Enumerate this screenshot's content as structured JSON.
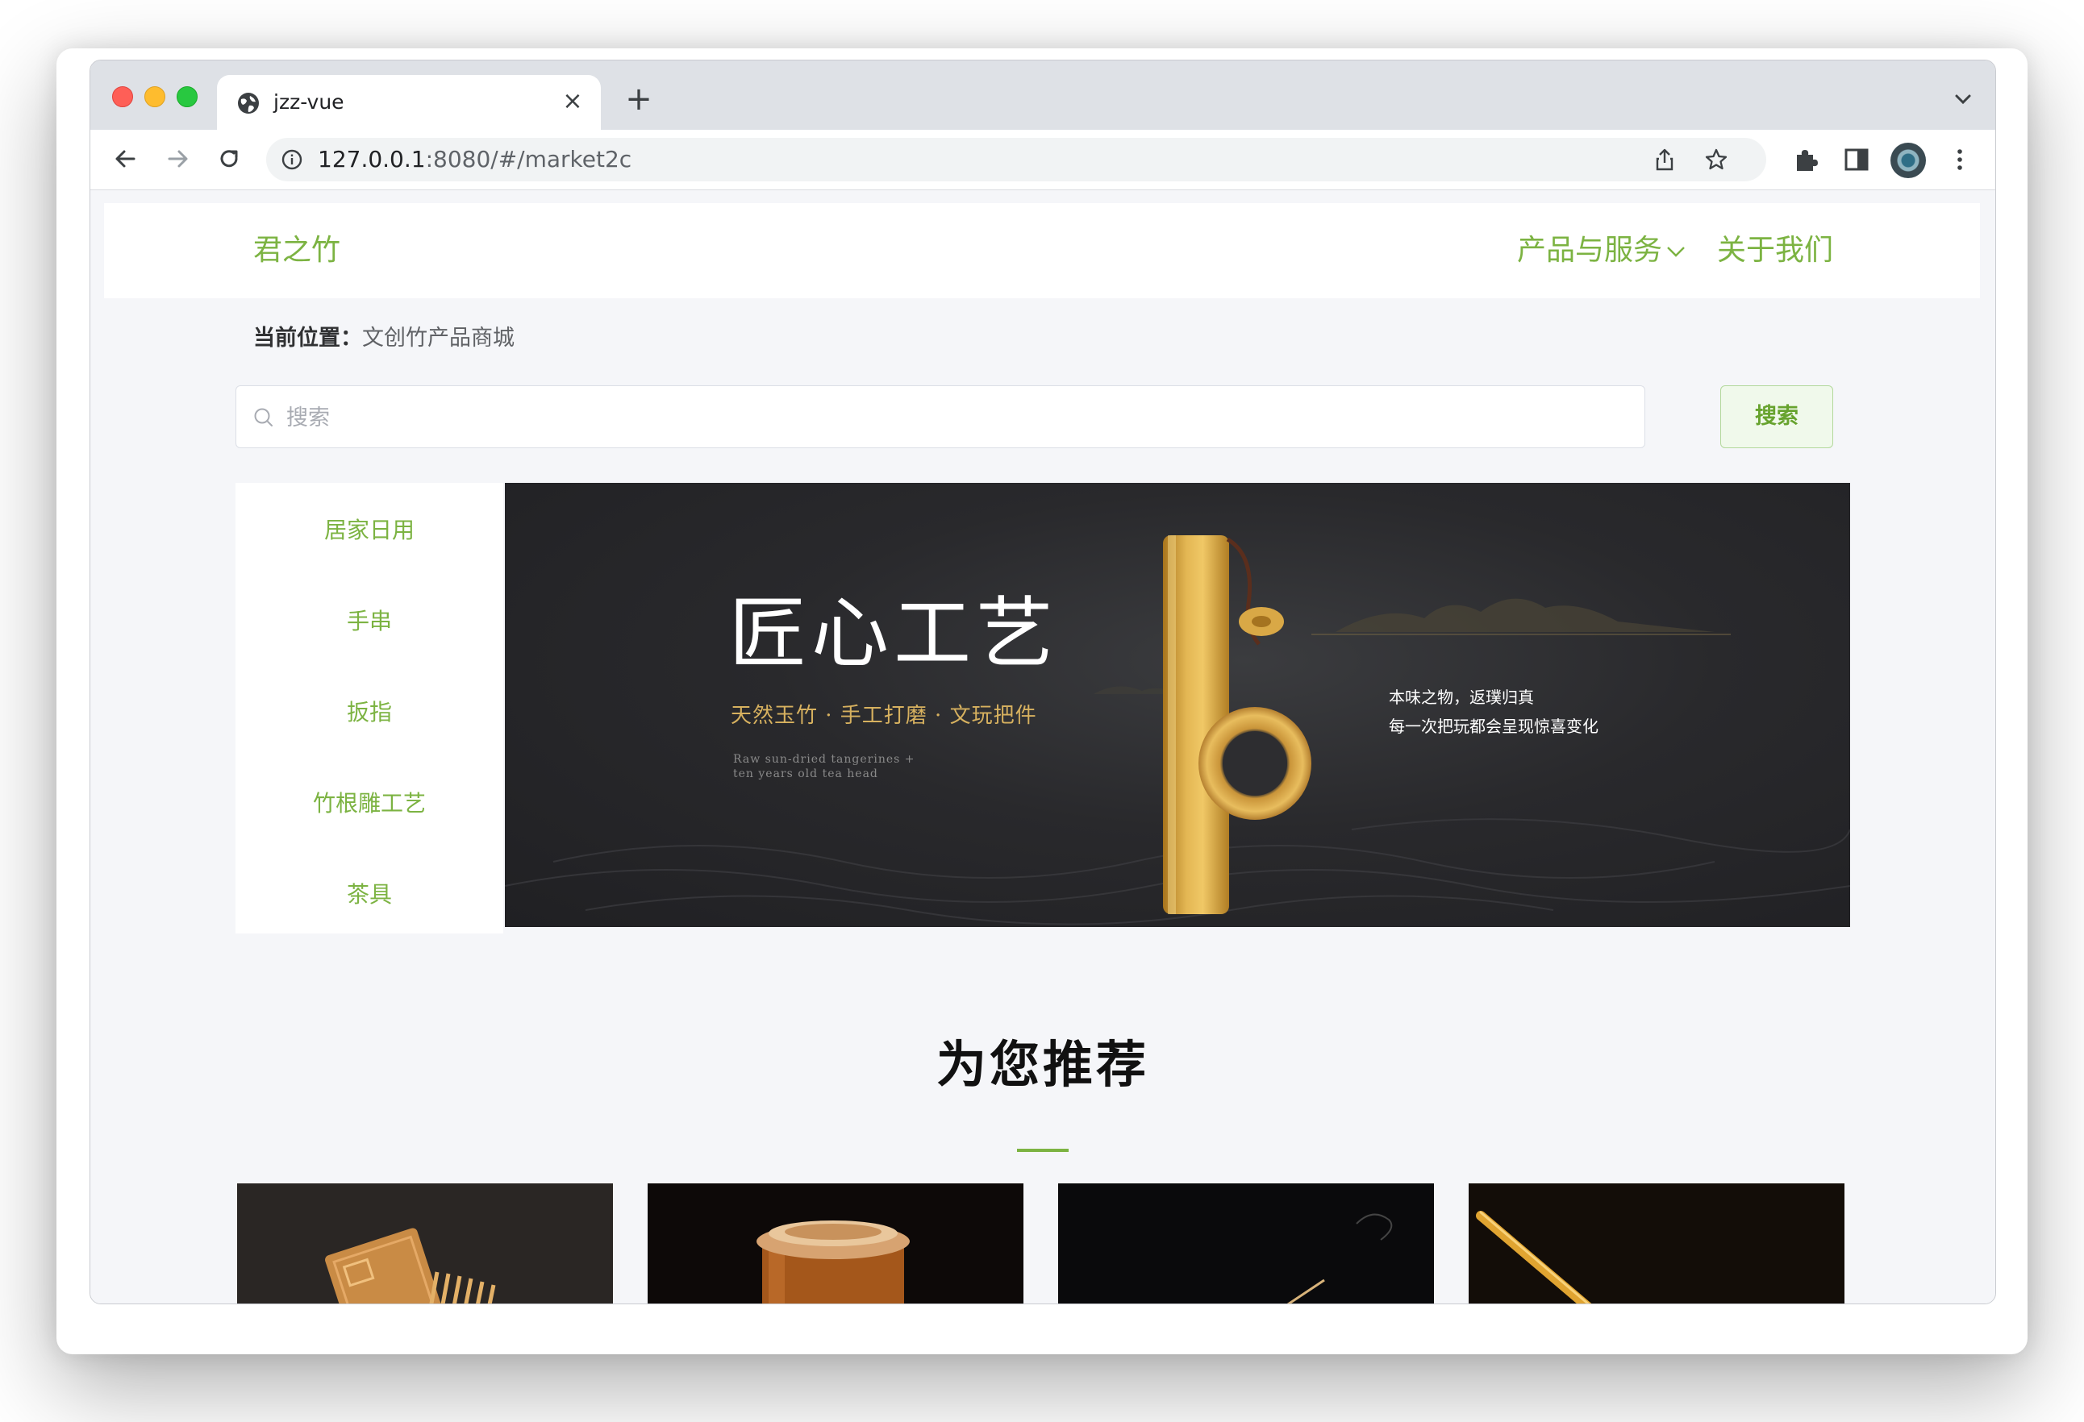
{
  "browser": {
    "tab_title": "jzz-vue",
    "url_host": "127.0.0.1",
    "url_rest": ":8080/#/market2c"
  },
  "header": {
    "logo": "君之竹",
    "menu_products": "产品与服务",
    "menu_about": "关于我们"
  },
  "breadcrumb": {
    "label": "当前位置：",
    "current": "文创竹产品商城"
  },
  "search": {
    "placeholder": "搜索",
    "button": "搜索"
  },
  "categories": [
    "居家日用",
    "手串",
    "扳指",
    "竹根雕工艺",
    "茶具"
  ],
  "banner": {
    "title": "匠心工艺",
    "subtitle": "天然玉竹 · 手工打磨 · 文玩把件",
    "english": "Raw sun-dried tangerines + ten years old tea head",
    "right_line1": "本味之物，返璞归真",
    "right_line2": "每一次把玩都会呈现惊喜变化"
  },
  "recommend": {
    "title": "为您推荐"
  },
  "colors": {
    "accent": "#7cb342",
    "page_bg": "#f5f6f9",
    "banner_gold": "#d7b15f"
  }
}
